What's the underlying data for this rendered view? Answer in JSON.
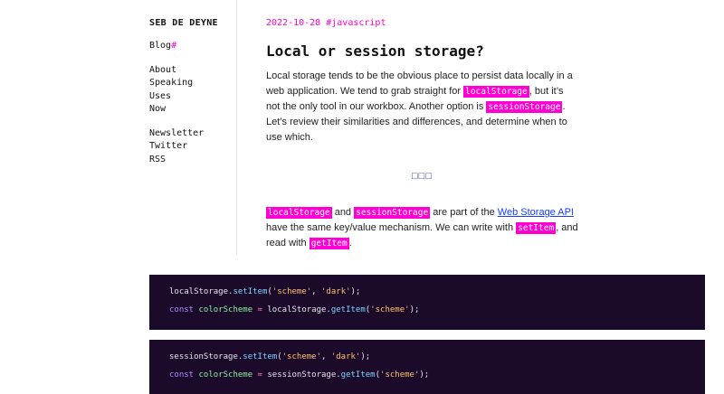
{
  "sidebar": {
    "site_title": "SEB DE DEYNE",
    "blog_label": "Blog",
    "blog_hash": "#",
    "links_group1": [
      "About",
      "Speaking",
      "Uses",
      "Now"
    ],
    "links_group2": [
      "Newsletter",
      "Twitter",
      "RSS"
    ]
  },
  "article": {
    "date": "2022-10-28",
    "tag": "#javascript",
    "title": "Local or session storage?",
    "para1": {
      "t1": "Local storage tends to be the obvious place to persist data locally in a web application. We tend to grab straight for ",
      "c1": "localStorage",
      "t2": ", but it’s not the only tool in our workbox. Another option is ",
      "c2": "sessionStorage",
      "t3": ". Let’s review their similarities and differences, and determine when to use which."
    },
    "separator": "□□□",
    "para2": {
      "c1": "localStorage",
      "t1": " and ",
      "c2": "sessionStorage",
      "t2": " are part of the ",
      "link": "Web Storage API",
      "t3": " have the same key/value mechanism. We can write with ",
      "c3": "setItem",
      "t4": ", and read with ",
      "c4": "getItem",
      "t5": "."
    }
  },
  "code_blocks": [
    {
      "line1": {
        "obj": "localStorage",
        "dot": ".",
        "fn": "setItem",
        "open": "(",
        "a1": "'scheme'",
        "comma": ", ",
        "a2": "'dark'",
        "close": ");"
      },
      "line2": {
        "kw": "const",
        "var": "colorScheme",
        "eq": " = ",
        "obj": "localStorage",
        "dot": ".",
        "fn": "getItem",
        "open": "(",
        "a1": "'scheme'",
        "close": ");"
      }
    },
    {
      "line1": {
        "obj": "sessionStorage",
        "dot": ".",
        "fn": "setItem",
        "open": "(",
        "a1": "'scheme'",
        "comma": ", ",
        "a2": "'dark'",
        "close": ");"
      },
      "line2": {
        "kw": "const",
        "var": "colorScheme",
        "eq": " = ",
        "obj": "sessionStorage",
        "dot": ".",
        "fn": "getItem",
        "open": "(",
        "a1": "'scheme'",
        "close": ");"
      }
    }
  ],
  "colors": {
    "accent": "#ff00cc",
    "code_bg": "#1b0a2a",
    "link": "#1a3cff"
  }
}
